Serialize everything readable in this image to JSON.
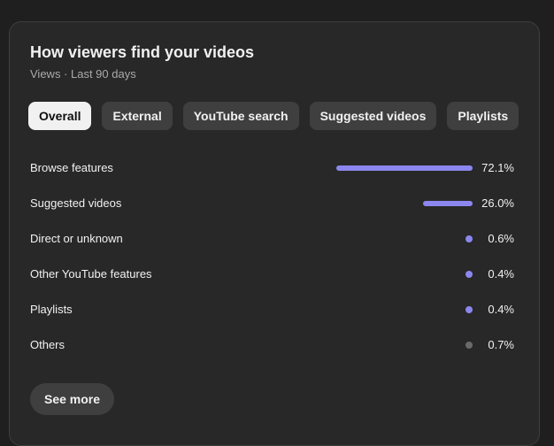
{
  "card": {
    "title": "How viewers find your videos",
    "subtitle": "Views · Last 90 days"
  },
  "tabs": [
    {
      "label": "Overall",
      "active": true
    },
    {
      "label": "External",
      "active": false
    },
    {
      "label": "YouTube search",
      "active": false
    },
    {
      "label": "Suggested videos",
      "active": false
    },
    {
      "label": "Playlists",
      "active": false
    }
  ],
  "sources": [
    {
      "label": "Browse features",
      "value": "72.1%",
      "percent": 72.1,
      "color": "#8b87ee"
    },
    {
      "label": "Suggested videos",
      "value": "26.0%",
      "percent": 26.0,
      "color": "#8b87ee"
    },
    {
      "label": "Direct or unknown",
      "value": "0.6%",
      "percent": 0.6,
      "color": "#8b87ee"
    },
    {
      "label": "Other YouTube features",
      "value": "0.4%",
      "percent": 0.4,
      "color": "#8b87ee"
    },
    {
      "label": "Playlists",
      "value": "0.4%",
      "percent": 0.4,
      "color": "#8b87ee"
    },
    {
      "label": "Others",
      "value": "0.7%",
      "percent": 0.7,
      "color": "#6a6a6a"
    }
  ],
  "footer": {
    "see_more_label": "See more"
  }
}
